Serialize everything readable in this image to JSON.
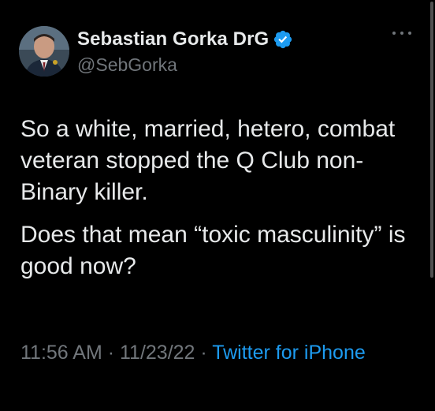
{
  "author": {
    "display_name": "Sebastian Gorka DrG",
    "handle": "@SebGorka",
    "avatar_icon": "profile-photo",
    "verified_icon": "verified-badge-icon"
  },
  "tweet": {
    "paragraph_1": "So a white, married, hetero, combat veteran stopped the Q Club non-Binary killer.",
    "paragraph_2": "Does that mean “toxic masculinity” is good now?"
  },
  "meta": {
    "time": "11:56 AM",
    "separator_1": " · ",
    "date": "11/23/22",
    "separator_2": " · ",
    "source": "Twitter for iPhone"
  },
  "colors": {
    "background": "#000000",
    "text_primary": "#e7e9ea",
    "text_secondary": "#71767b",
    "link": "#1d9bf0",
    "verified": "#1d9bf0"
  }
}
